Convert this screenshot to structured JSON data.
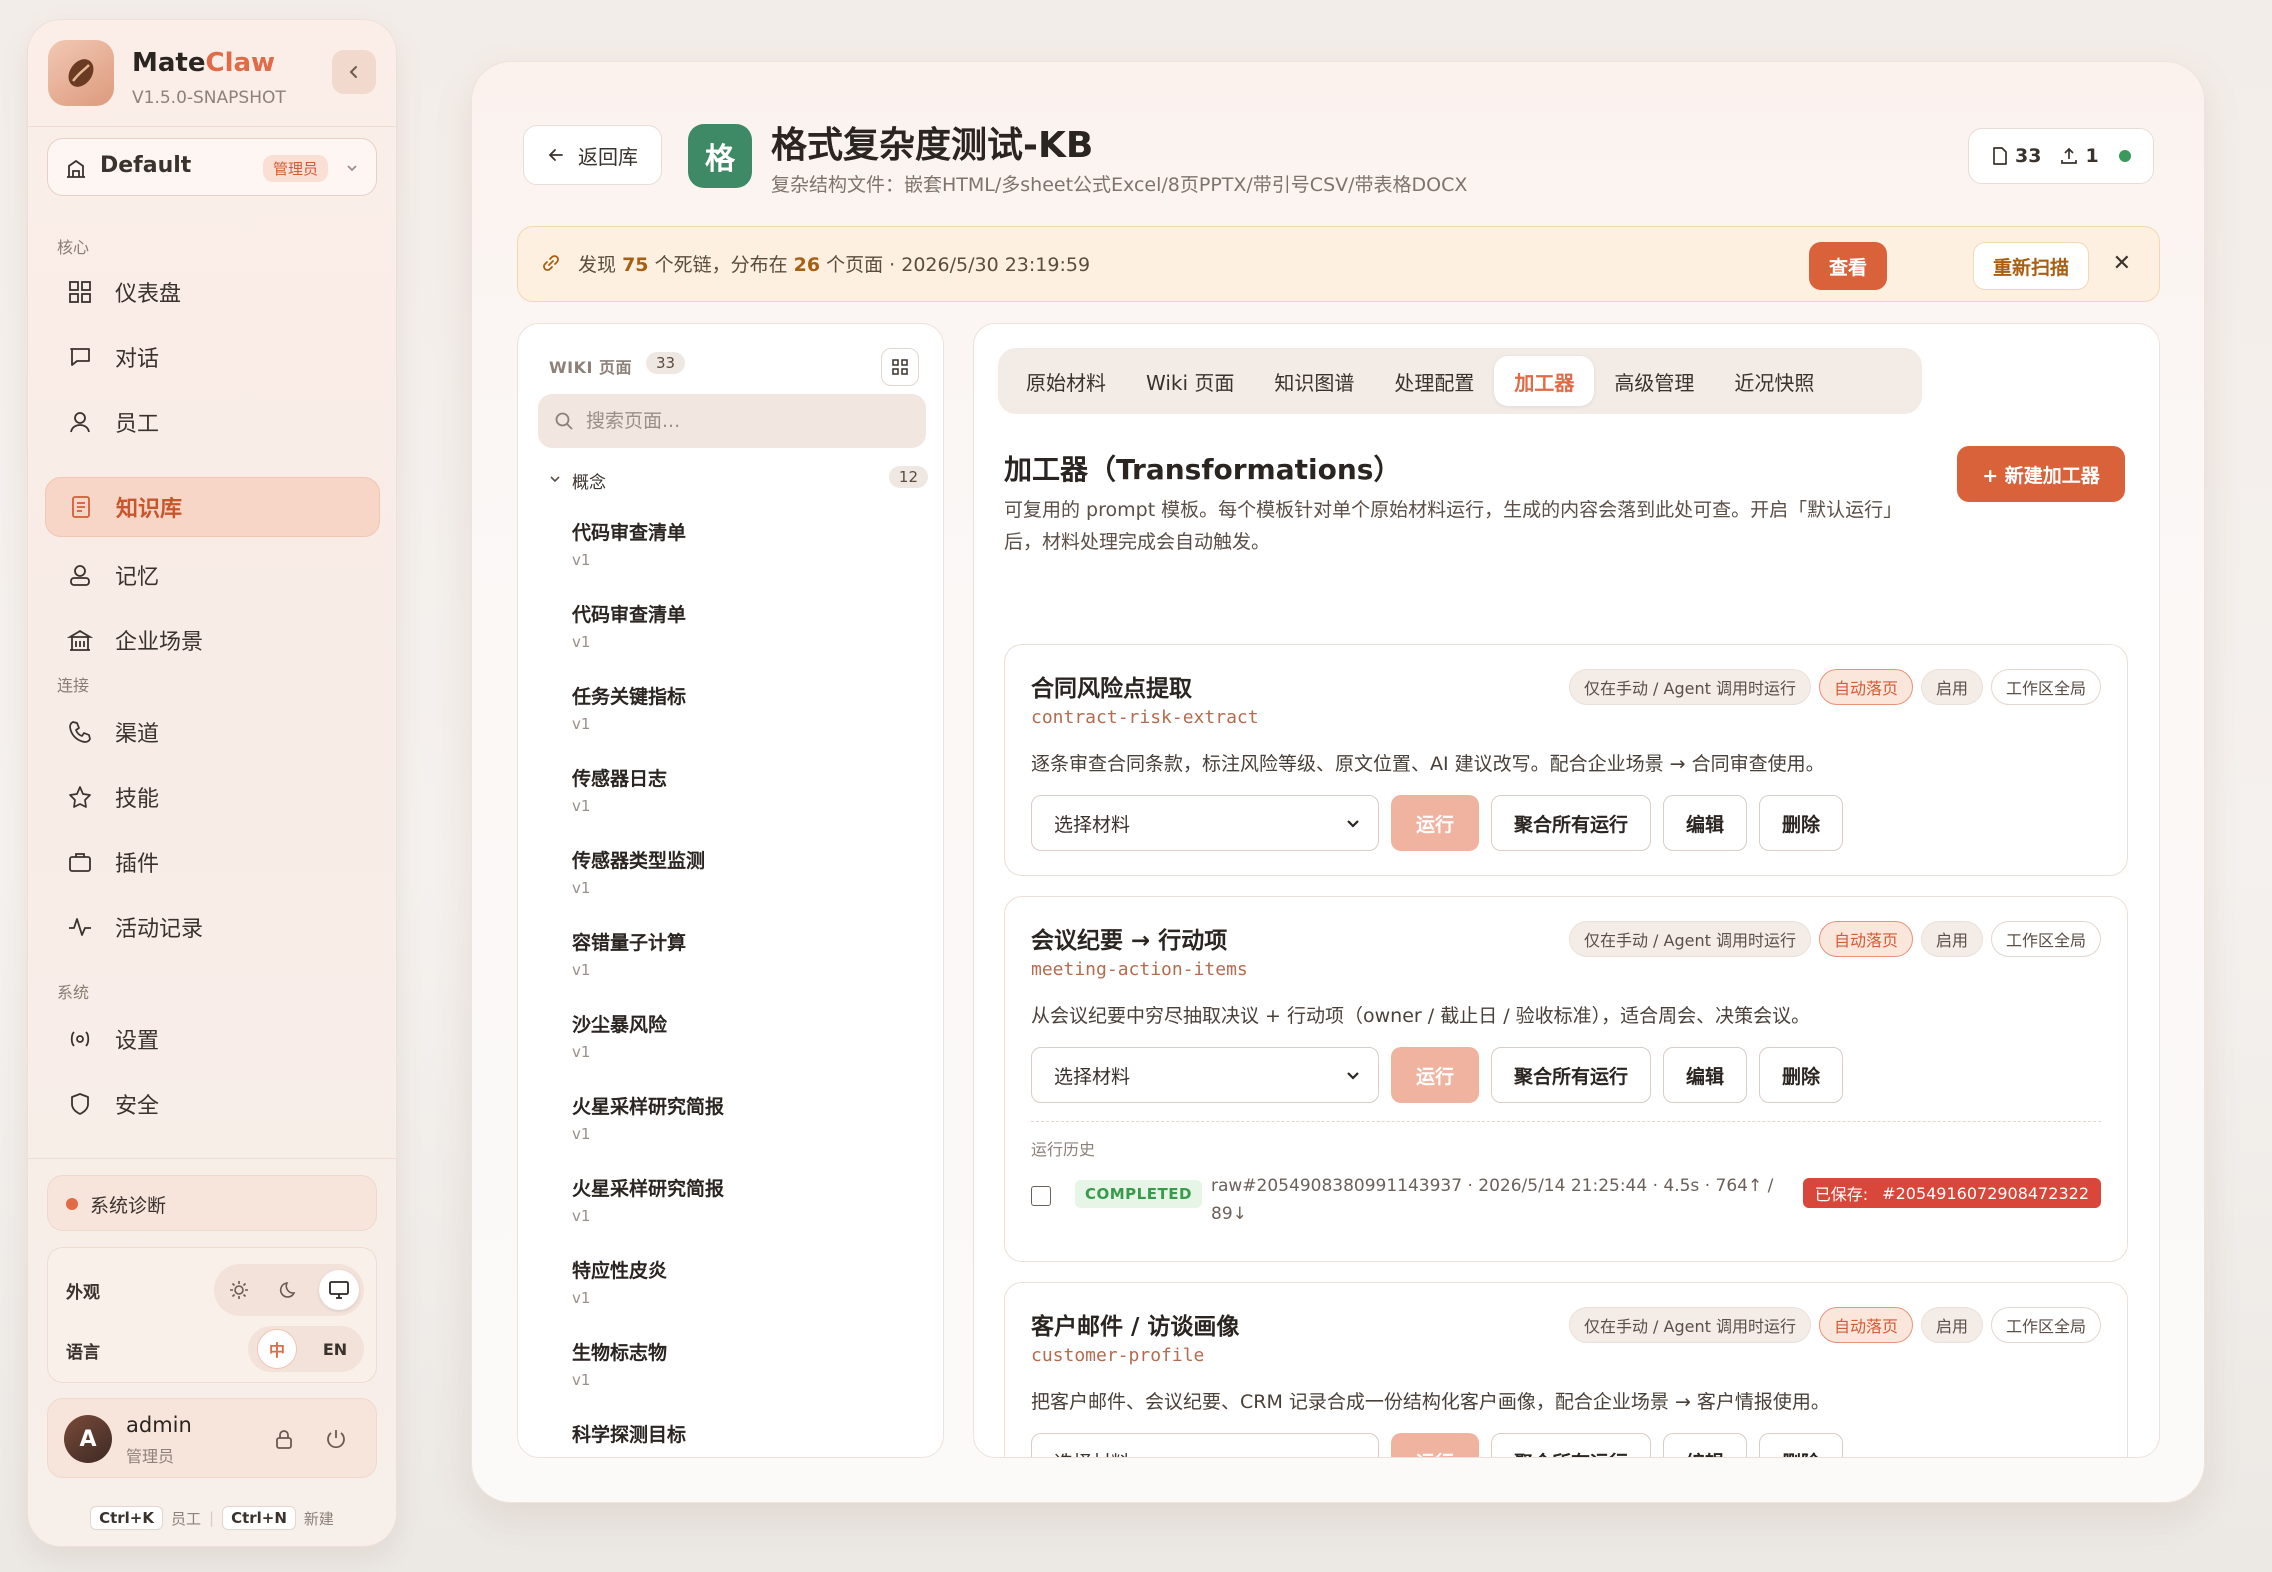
{
  "brand": {
    "name_a": "Mate",
    "name_b": "Claw",
    "version": "V1.5.0-SNAPSHOT"
  },
  "workspace": {
    "name": "Default",
    "role_badge": "管理员"
  },
  "sidebar": {
    "sections": {
      "core": "核心",
      "connect": "连接",
      "system": "系统"
    },
    "items": [
      {
        "label": "仪表盘",
        "icon": "dashboard-icon"
      },
      {
        "label": "对话",
        "icon": "chat-icon"
      },
      {
        "label": "员工",
        "icon": "person-icon"
      },
      {
        "label": "知识库",
        "icon": "book-icon",
        "active": true
      },
      {
        "label": "记忆",
        "icon": "memory-icon"
      },
      {
        "label": "企业场景",
        "icon": "building-icon"
      },
      {
        "label": "渠道",
        "icon": "phone-icon"
      },
      {
        "label": "技能",
        "icon": "star-icon"
      },
      {
        "label": "插件",
        "icon": "plugin-icon"
      },
      {
        "label": "活动记录",
        "icon": "activity-icon"
      },
      {
        "label": "设置",
        "icon": "settings-icon"
      },
      {
        "label": "安全",
        "icon": "shield-icon"
      }
    ],
    "diagnostics": "系统诊断",
    "appearance_label": "外观",
    "language_label": "语言",
    "lang_zh": "中",
    "lang_en": "EN",
    "user": {
      "initial": "A",
      "name": "admin",
      "role": "管理员"
    },
    "shortcuts": {
      "k1": "Ctrl+K",
      "k1_label": "员工",
      "k2": "Ctrl+N",
      "k2_label": "新建"
    }
  },
  "header": {
    "back_label": "返回库",
    "kb_initial": "格",
    "kb_title": "格式复杂度测试-KB",
    "kb_subtitle": "复杂结构文件：嵌套HTML/多sheet公式Excel/8页PPTX/带引号CSV/带表格DOCX",
    "stat_docs": "33",
    "stat_uploads": "1"
  },
  "alert": {
    "prefix": "发现",
    "dead_links": "75",
    "mid": "个死链，分布在",
    "pages": "26",
    "suffix": "个页面 · 2026/5/30 23:19:59",
    "view_label": "查看",
    "rescan_label": "重新扫描"
  },
  "wiki": {
    "title": "WIKI 页面",
    "count": "33",
    "search_placeholder": "搜索页面...",
    "group_label": "概念",
    "group_count": "12",
    "pages": [
      {
        "title": "代码审查清单",
        "version": "v1"
      },
      {
        "title": "代码审查清单",
        "version": "v1"
      },
      {
        "title": "任务关键指标",
        "version": "v1"
      },
      {
        "title": "传感器日志",
        "version": "v1"
      },
      {
        "title": "传感器类型监测",
        "version": "v1"
      },
      {
        "title": "容错量子计算",
        "version": "v1"
      },
      {
        "title": "沙尘暴风险",
        "version": "v1"
      },
      {
        "title": "火星采样研究简报",
        "version": "v1"
      },
      {
        "title": "火星采样研究简报",
        "version": "v1"
      },
      {
        "title": "特应性皮炎",
        "version": "v1"
      },
      {
        "title": "生物标志物",
        "version": "v1"
      },
      {
        "title": "科学探测目标",
        "version": ""
      }
    ]
  },
  "tabs": [
    "原始材料",
    "Wiki 页面",
    "知识图谱",
    "处理配置",
    "加工器",
    "高级管理",
    "近况快照"
  ],
  "active_tab": 4,
  "transforms": {
    "heading": "加工器（Transformations）",
    "description": "可复用的 prompt 模板。每个模板针对单个原始材料运行，生成的内容会落到此处可查。开启「默认运行」后，材料处理完成会自动触发。",
    "new_label": "+ 新建加工器",
    "badge_trigger": "仅在手动 / Agent 调用时运行",
    "badge_auto": "自动落页",
    "badge_enabled": "启用",
    "badge_scope": "工作区全局",
    "select_placeholder": "选择材料",
    "run_label": "运行",
    "aggregate_label": "聚合所有运行",
    "edit_label": "编辑",
    "delete_label": "删除",
    "cards": [
      {
        "title": "合同风险点提取",
        "id": "contract-risk-extract",
        "desc": "逐条审查合同条款，标注风险等级、原文位置、AI 建议改写。配合企业场景 → 合同审查使用。"
      },
      {
        "title": "会议纪要 → 行动项",
        "id": "meeting-action-items",
        "desc": "从会议纪要中穷尽抽取决议 + 行动项（owner / 截止日 / 验收标准），适合周会、决策会议。",
        "history": {
          "label": "运行历史",
          "status": "COMPLETED",
          "meta": "raw#2054908380991143937 · 2026/5/14 21:25:44 · 4.5s · 764↑ / 89↓",
          "saved_label": "已保存:",
          "saved_id": "#2054916072908472322"
        }
      },
      {
        "title": "客户邮件 / 访谈画像",
        "id": "customer-profile",
        "desc": "把客户邮件、会议纪要、CRM 记录合成一份结构化客户画像，配合企业场景 → 客户情报使用。"
      }
    ]
  }
}
